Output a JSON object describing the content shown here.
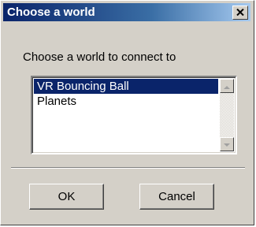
{
  "window": {
    "title": "Choose a world",
    "close_icon": "close-x-icon",
    "title_gradient": [
      "#0a246a",
      "#3a6ea5",
      "#a6caf0"
    ],
    "face_color": "#d4d0c8"
  },
  "dialog": {
    "prompt": "Choose a world to connect to"
  },
  "world_list": {
    "items": [
      {
        "label": "VR Bouncing Ball",
        "selected": true
      },
      {
        "label": "Planets",
        "selected": false
      }
    ],
    "selection_color": "#0a246a",
    "scroll_up_icon": "triangle-up-icon",
    "scroll_down_icon": "triangle-down-icon"
  },
  "buttons": {
    "ok_label": "OK",
    "cancel_label": "Cancel"
  }
}
